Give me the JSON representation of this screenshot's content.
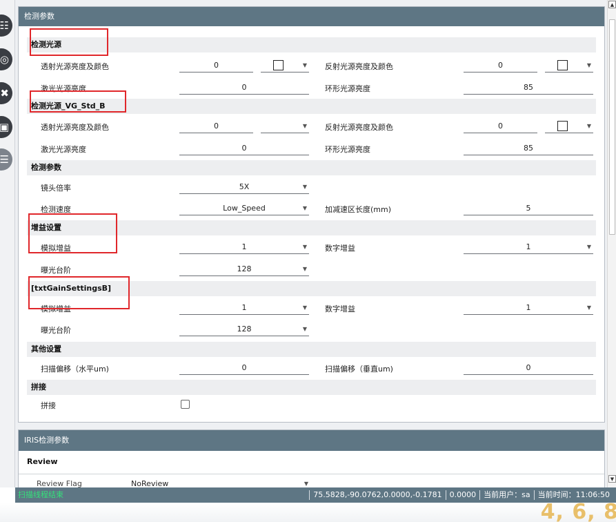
{
  "sidebar": {
    "icons": [
      "globe-icon",
      "podcast-icon",
      "tools-icon",
      "image-icon",
      "list-icon"
    ]
  },
  "panel1": {
    "title": "检测参数",
    "sections": {
      "s1": "检测光源",
      "s2": "检测光源_VG_Std_B",
      "s3": "检测参数",
      "s4": "增益设置",
      "s5": "[txtGainSettingsB]",
      "s6": "其他设置",
      "s7": "拼接"
    },
    "labels": {
      "transmit_brightness_color": "透射光源亮度及颜色",
      "reflect_brightness_color": "反射光源亮度及颜色",
      "laser_brightness": "激光光源亮度",
      "ring_brightness": "环形光源亮度",
      "lens_magnification": "镜头倍率",
      "detect_speed": "检测速度",
      "accel_zone_length": "加减速区长度(mm)",
      "analog_gain": "模拟增益",
      "digital_gain": "数字增益",
      "exposure_level": "曝光台阶",
      "scan_offset_h": "扫描偏移（水平um)",
      "scan_offset_v": "扫描偏移（垂直um)",
      "stitch": "拼接"
    },
    "values": {
      "s1_transmit": "0",
      "s1_reflect": "0",
      "s1_laser": "0",
      "s1_ring": "85",
      "s2_transmit": "0",
      "s2_reflect": "0",
      "s2_laser": "0",
      "s2_ring": "85",
      "lens": "5X",
      "speed": "Low_Speed",
      "accel": "5",
      "s4_analog": "1",
      "s4_digital": "1",
      "s4_exposure": "128",
      "s5_analog": "1",
      "s5_digital": "1",
      "s5_exposure": "128",
      "offset_h": "0",
      "offset_v": "0"
    },
    "colors": {
      "swatch_s1_transmit": "#ffffff",
      "swatch_s1_reflect": "#ffffff",
      "swatch_s2_reflect": "#ffffff"
    },
    "stitch_checked": false
  },
  "panel2": {
    "title": "IRIS检测参数",
    "section": "Review",
    "review_flag_label": "Review Flag",
    "review_flag_value": "NoReview"
  },
  "status": {
    "left": "扫描线程结束",
    "coords": "75.5828,-90.0762,0.0000,-0.1781",
    "value": "0.0000",
    "user": "当前用户：sa",
    "time": "当前时间：11:06:50"
  },
  "pagenums": "4, 6, 8",
  "colors": {
    "header_bg": "#5e7684",
    "section_bg": "#edeef0",
    "highlight_red": "#e0262a",
    "status_ok": "#34e27a"
  }
}
